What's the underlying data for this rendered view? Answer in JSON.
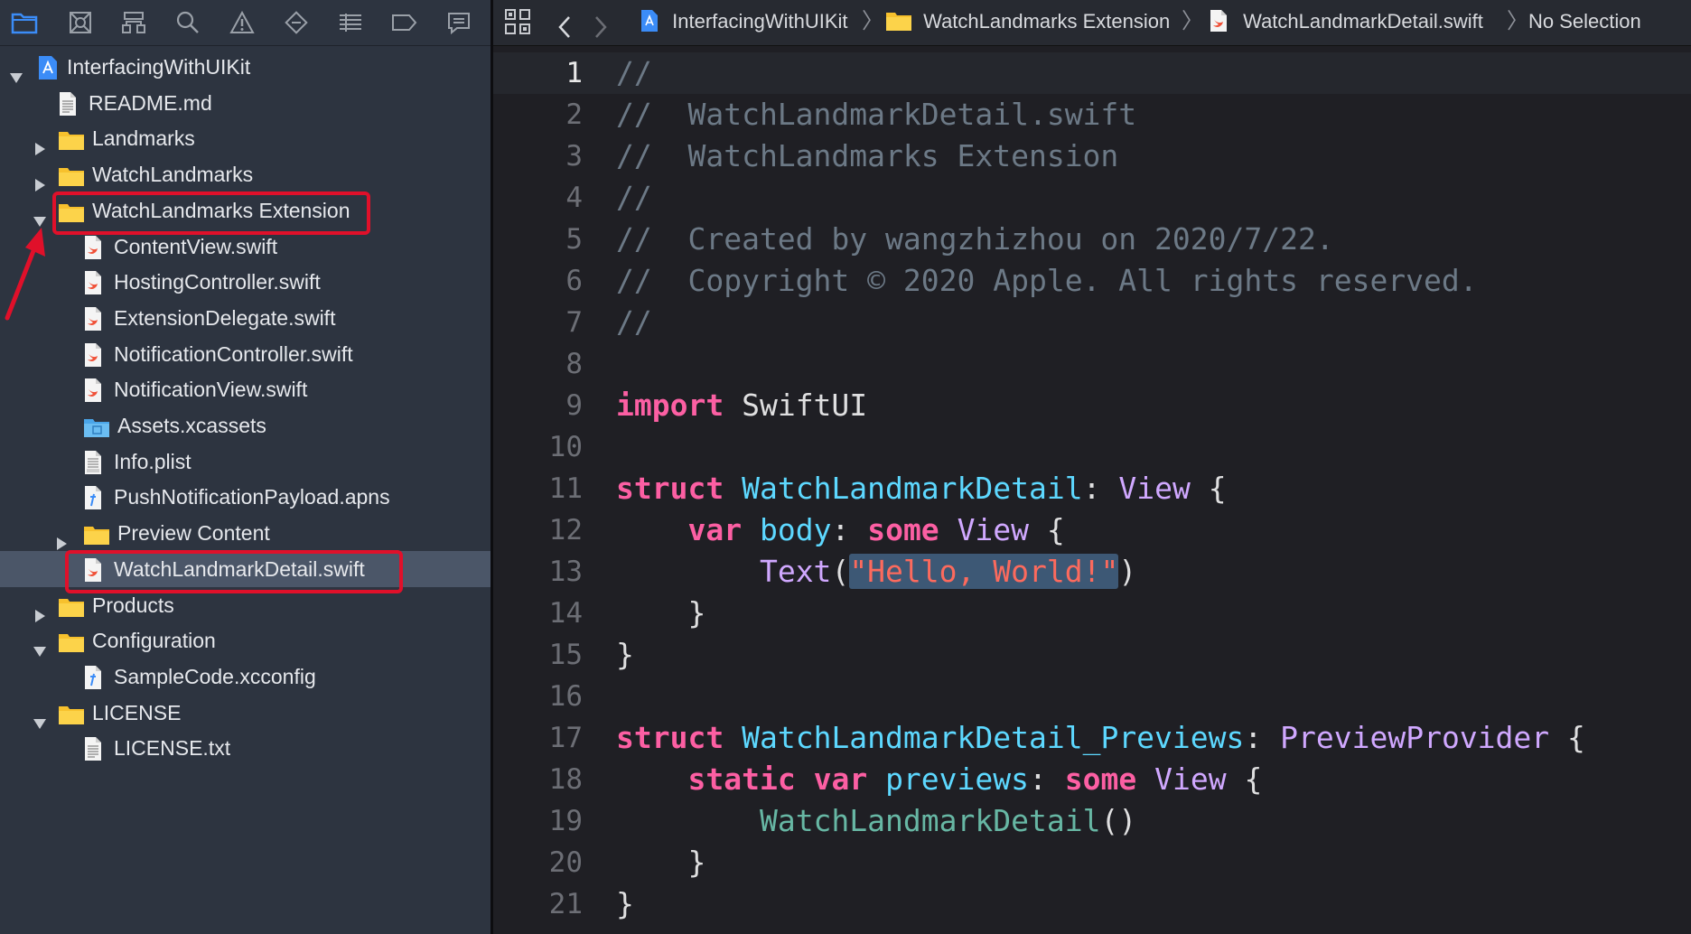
{
  "navigator": {
    "toolbar_icons": [
      "folder-icon",
      "source-control-icon",
      "hierarchy-icon",
      "search-icon",
      "warning-icon",
      "test-icon",
      "debug-icon",
      "breakpoint-icon",
      "report-icon"
    ],
    "tree": [
      {
        "label": "InterfacingWithUIKit",
        "indent": 0,
        "icon": "project-icon",
        "disclosure": "open"
      },
      {
        "label": "README.md",
        "indent": 1,
        "icon": "doc-icon",
        "disclosure": "none"
      },
      {
        "label": "Landmarks",
        "indent": 1,
        "icon": "folder-icon",
        "disclosure": "closed"
      },
      {
        "label": "WatchLandmarks",
        "indent": 1,
        "icon": "folder-icon",
        "disclosure": "closed"
      },
      {
        "label": "WatchLandmarks Extension",
        "indent": 1,
        "icon": "folder-icon",
        "disclosure": "open",
        "highlighted": true
      },
      {
        "label": "ContentView.swift",
        "indent": 2,
        "icon": "swift-file-icon",
        "disclosure": "none"
      },
      {
        "label": "HostingController.swift",
        "indent": 2,
        "icon": "swift-file-icon",
        "disclosure": "none"
      },
      {
        "label": "ExtensionDelegate.swift",
        "indent": 2,
        "icon": "swift-file-icon",
        "disclosure": "none"
      },
      {
        "label": "NotificationController.swift",
        "indent": 2,
        "icon": "swift-file-icon",
        "disclosure": "none"
      },
      {
        "label": "NotificationView.swift",
        "indent": 2,
        "icon": "swift-file-icon",
        "disclosure": "none"
      },
      {
        "label": "Assets.xcassets",
        "indent": 2,
        "icon": "assets-folder-icon",
        "disclosure": "none"
      },
      {
        "label": "Info.plist",
        "indent": 2,
        "icon": "plist-file-icon",
        "disclosure": "none"
      },
      {
        "label": "PushNotificationPayload.apns",
        "indent": 2,
        "icon": "text-file-icon",
        "disclosure": "none"
      },
      {
        "label": "Preview Content",
        "indent": 2,
        "icon": "folder-icon",
        "disclosure": "closed"
      },
      {
        "label": "WatchLandmarkDetail.swift",
        "indent": 2,
        "icon": "swift-file-icon",
        "disclosure": "none",
        "selected": true,
        "highlighted": true
      },
      {
        "label": "Products",
        "indent": 1,
        "icon": "folder-icon",
        "disclosure": "closed"
      },
      {
        "label": "Configuration",
        "indent": 1,
        "icon": "folder-icon",
        "disclosure": "open"
      },
      {
        "label": "SampleCode.xcconfig",
        "indent": 2,
        "icon": "text-file-icon",
        "disclosure": "none"
      },
      {
        "label": "LICENSE",
        "indent": 1,
        "icon": "folder-icon",
        "disclosure": "open"
      },
      {
        "label": "LICENSE.txt",
        "indent": 2,
        "icon": "doc-icon",
        "disclosure": "none"
      }
    ]
  },
  "jumpbar": {
    "project": "InterfacingWithUIKit",
    "group": "WatchLandmarks Extension",
    "file": "WatchLandmarkDetail.swift",
    "selection": "No Selection",
    "separator": "〉"
  },
  "editor": {
    "current_line": 1,
    "lines": [
      {
        "n": "1",
        "tokens": [
          [
            "cm",
            "//"
          ]
        ]
      },
      {
        "n": "2",
        "tokens": [
          [
            "cm",
            "//  WatchLandmarkDetail.swift"
          ]
        ]
      },
      {
        "n": "3",
        "tokens": [
          [
            "cm",
            "//  WatchLandmarks Extension"
          ]
        ]
      },
      {
        "n": "4",
        "tokens": [
          [
            "cm",
            "//"
          ]
        ]
      },
      {
        "n": "5",
        "tokens": [
          [
            "cm",
            "//  Created by wangzhizhou on 2020/7/22."
          ]
        ]
      },
      {
        "n": "6",
        "tokens": [
          [
            "cm",
            "//  Copyright © 2020 Apple. All rights reserved."
          ]
        ]
      },
      {
        "n": "7",
        "tokens": [
          [
            "cm",
            "//"
          ]
        ]
      },
      {
        "n": "8",
        "tokens": []
      },
      {
        "n": "9",
        "tokens": [
          [
            "kw",
            "import"
          ],
          [
            "pl",
            " SwiftUI"
          ]
        ]
      },
      {
        "n": "10",
        "tokens": []
      },
      {
        "n": "11",
        "tokens": [
          [
            "kw",
            "struct"
          ],
          [
            "pl",
            " "
          ],
          [
            "ty",
            "WatchLandmarkDetail"
          ],
          [
            "pl",
            ": "
          ],
          [
            "tp",
            "View"
          ],
          [
            "pl",
            " {"
          ]
        ]
      },
      {
        "n": "12",
        "tokens": [
          [
            "pl",
            "    "
          ],
          [
            "kw",
            "var"
          ],
          [
            "pl",
            " "
          ],
          [
            "ty",
            "body"
          ],
          [
            "pl",
            ": "
          ],
          [
            "kw",
            "some"
          ],
          [
            "pl",
            " "
          ],
          [
            "tp",
            "View"
          ],
          [
            "pl",
            " {"
          ]
        ]
      },
      {
        "n": "13",
        "tokens": [
          [
            "pl",
            "        "
          ],
          [
            "tp",
            "Text"
          ],
          [
            "pl",
            "("
          ],
          [
            "st sel",
            "\"Hello, World!\""
          ],
          [
            "pl",
            ")"
          ]
        ]
      },
      {
        "n": "14",
        "tokens": [
          [
            "pl",
            "    }"
          ]
        ]
      },
      {
        "n": "15",
        "tokens": [
          [
            "pl",
            "}"
          ]
        ]
      },
      {
        "n": "16",
        "tokens": []
      },
      {
        "n": "17",
        "tokens": [
          [
            "kw",
            "struct"
          ],
          [
            "pl",
            " "
          ],
          [
            "ty",
            "WatchLandmarkDetail_Previews"
          ],
          [
            "pl",
            ": "
          ],
          [
            "tp",
            "PreviewProvider"
          ],
          [
            "pl",
            " {"
          ]
        ]
      },
      {
        "n": "18",
        "tokens": [
          [
            "pl",
            "    "
          ],
          [
            "kw",
            "static"
          ],
          [
            "pl",
            " "
          ],
          [
            "kw",
            "var"
          ],
          [
            "pl",
            " "
          ],
          [
            "ty",
            "previews"
          ],
          [
            "pl",
            ": "
          ],
          [
            "kw",
            "some"
          ],
          [
            "pl",
            " "
          ],
          [
            "tp",
            "View"
          ],
          [
            "pl",
            " {"
          ]
        ]
      },
      {
        "n": "19",
        "tokens": [
          [
            "pl",
            "        "
          ],
          [
            "fn",
            "WatchLandmarkDetail"
          ],
          [
            "pl",
            "()"
          ]
        ]
      },
      {
        "n": "20",
        "tokens": [
          [
            "pl",
            "    }"
          ]
        ]
      },
      {
        "n": "21",
        "tokens": [
          [
            "pl",
            "}"
          ]
        ]
      }
    ]
  },
  "colors": {
    "navigator_bg": "#2d3440",
    "editor_bg": "#1f1f24",
    "selection_bg": "#4b5668",
    "highlight_red": "#e0102a",
    "accent_blue": "#3b8cf7"
  }
}
